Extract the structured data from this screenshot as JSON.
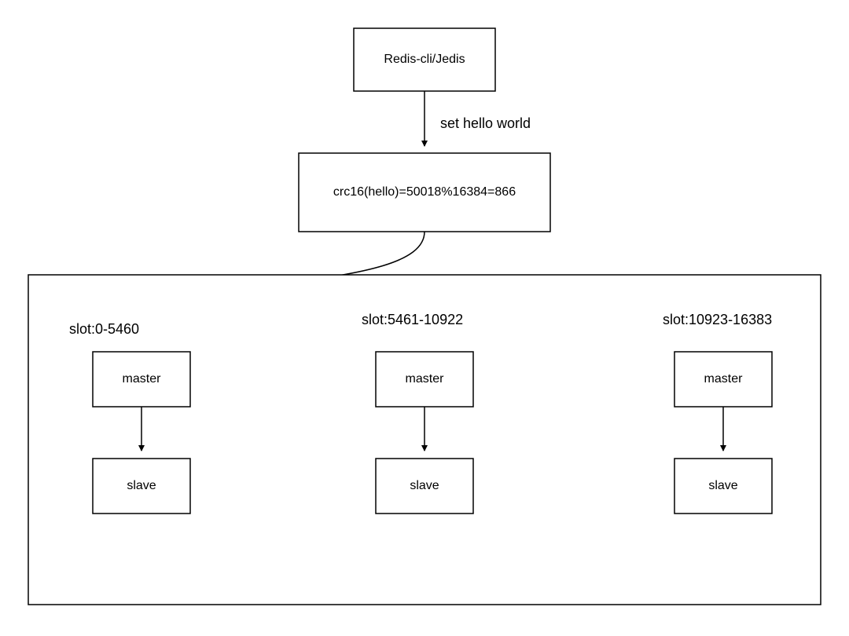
{
  "client": {
    "label": "Redis-cli/Jedis"
  },
  "command": {
    "label": "set hello world"
  },
  "hash": {
    "label": "crc16(hello)=50018%16384=866"
  },
  "clusters": [
    {
      "slot_label": "slot:0-5460",
      "master_label": "master",
      "slave_label": "slave"
    },
    {
      "slot_label": "slot:5461-10922",
      "master_label": "master",
      "slave_label": "slave"
    },
    {
      "slot_label": "slot:10923-16383",
      "master_label": "master",
      "slave_label": "slave"
    }
  ]
}
